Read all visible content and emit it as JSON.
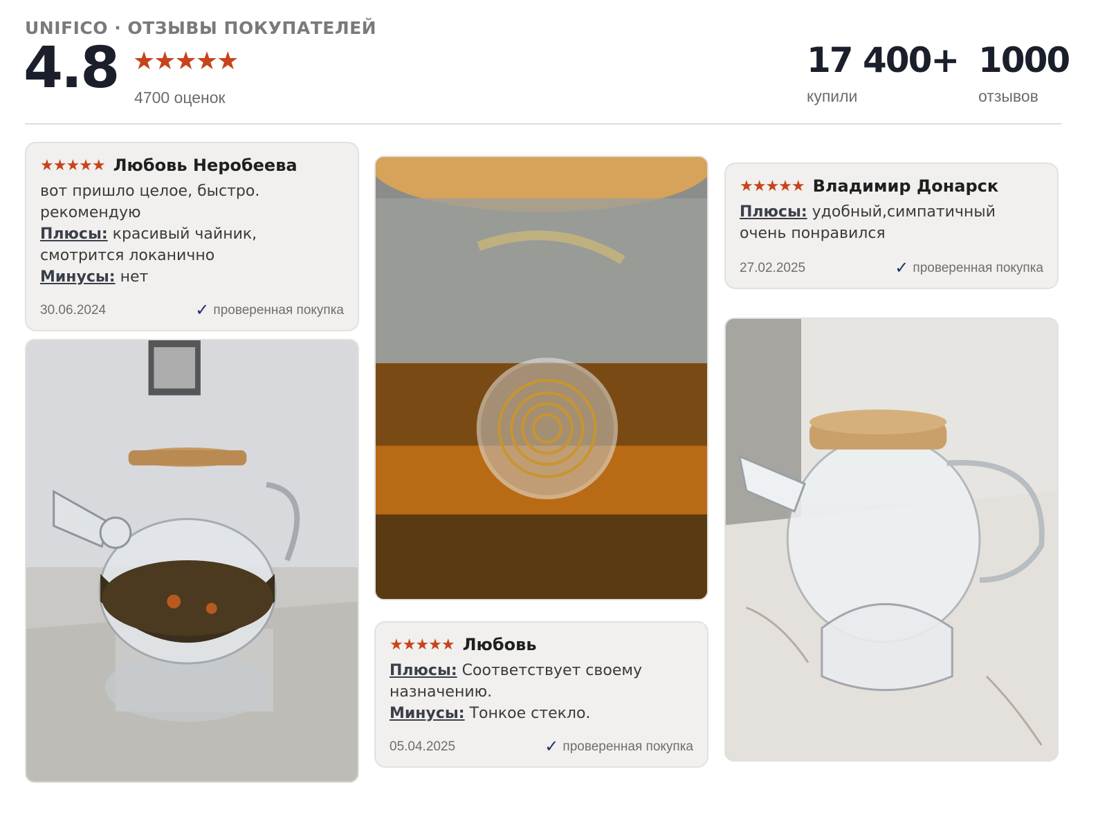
{
  "header": {
    "brand": "UNIFICO · ОТЗЫВЫ ПОКУПАТЕЛЕЙ",
    "rating": "4.8",
    "stars": "★★★★★",
    "ratings_count": "4700 оценок",
    "bought_value": "17 400+",
    "bought_label": "купили",
    "reviews_value": "1000",
    "reviews_label": "отзывов"
  },
  "reviews": [
    {
      "stars": "★★★★★",
      "author": "Любовь Неробеева",
      "body": "вот пришло целое, быстро. рекомендую",
      "pros_label": "Плюсы:",
      "pros": "красивый чайник, смотрится локанично",
      "cons_label": "Минусы:",
      "cons": "нет",
      "date": "30.06.2024",
      "verified": "проверенная покупка"
    },
    {
      "stars": "★★★★★",
      "author": "Владимир Донарск",
      "pros_label": "Плюсы:",
      "pros": "удобный,симпатичный очень понравился",
      "date": "27.02.2025",
      "verified": "проверенная покупка"
    },
    {
      "stars": "★★★★★",
      "author": "Любовь",
      "pros_label": "Плюсы:",
      "pros": "Соответствует своему назначению.",
      "cons_label": "Минусы:",
      "cons": "Тонкое стекло.",
      "date": "05.04.2025",
      "verified": "проверенная покупка"
    }
  ],
  "colors": {
    "accent_star": "#c8431a",
    "verified_check": "#1d2f68",
    "card_bg": "#f1f0ee"
  },
  "icons": {
    "star": "star-icon",
    "check": "check-icon"
  }
}
